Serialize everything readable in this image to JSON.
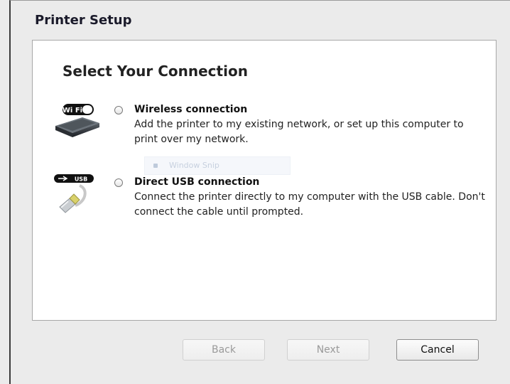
{
  "window": {
    "title": "Printer Setup"
  },
  "main": {
    "heading": "Select Your Connection",
    "options": [
      {
        "id": "wifi",
        "title": "Wireless connection",
        "description": "Add the printer to my existing network, or set up this computer to print over my network.",
        "icon_label": "Wi Fi",
        "icon": "wifi-router-icon",
        "selected": false
      },
      {
        "id": "usb",
        "title": "Direct USB connection",
        "description": "Connect the printer directly to my computer with the USB cable. Don't connect the cable until prompted.",
        "icon_label": "USB",
        "icon": "usb-cable-icon",
        "selected": false
      }
    ],
    "overlay": {
      "text": "Window Snip"
    }
  },
  "footer": {
    "back_label": "Back",
    "next_label": "Next",
    "cancel_label": "Cancel"
  },
  "colors": {
    "background": "#ebebeb",
    "panel": "#ffffff",
    "disabled_text": "#9a9a9a"
  }
}
